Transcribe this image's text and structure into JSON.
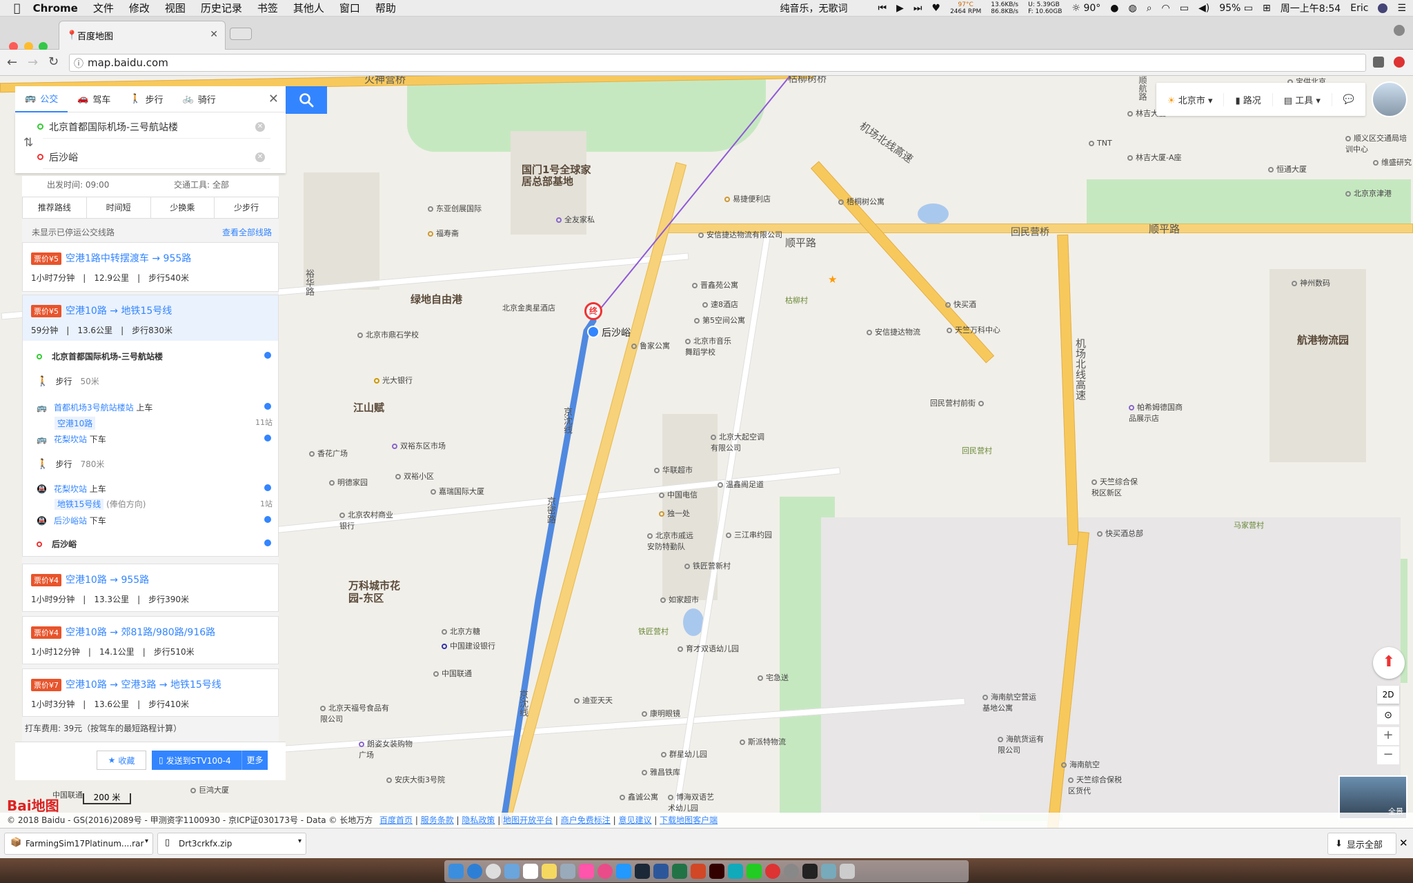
{
  "menubar": {
    "apple": "",
    "app": "Chrome",
    "items": [
      "文件",
      "修改",
      "视图",
      "历史记录",
      "书签",
      "其他人",
      "窗口",
      "帮助"
    ],
    "now_playing": "纯音乐，无歌词",
    "cpu_temp": "97°C",
    "fan": "2464 RPM",
    "net_up": "13.6KB/s",
    "net_down": "86.8KB/s",
    "mem_used": "5.39GB",
    "mem_free": "10.60GB",
    "weather": "90°",
    "battery": "95%",
    "clock": "周一上午8:54",
    "user": "Eric"
  },
  "tabs": {
    "active_title": "百度地图"
  },
  "address": {
    "url": "map.baidu.com"
  },
  "search": {
    "modes": [
      "公交",
      "驾车",
      "步行",
      "骑行"
    ],
    "start": "北京首都国际机场-三号航站楼",
    "end": "后沙峪",
    "depart_time": "出发时间: 09:00",
    "transport": "交通工具: 全部"
  },
  "sort": [
    "推荐路线",
    "时间短",
    "少换乘",
    "少步行"
  ],
  "notice": "未显示已停运公交线路",
  "view_all": "查看全部线路",
  "routes": [
    {
      "price": "票价¥5",
      "title": "空港1路中转摆渡车 → 955路",
      "time": "1小时7分钟",
      "dist": "12.9公里",
      "walk": "步行540米"
    },
    {
      "price": "票价¥5",
      "title": "空港10路 → 地铁15号线",
      "time": "59分钟",
      "dist": "13.6公里",
      "walk": "步行830米"
    },
    {
      "price": "票价¥4",
      "title": "空港10路 → 955路",
      "time": "1小时9分钟",
      "dist": "13.3公里",
      "walk": "步行390米"
    },
    {
      "price": "票价¥4",
      "title": "空港10路 → 郊81路/980路/916路",
      "time": "1小时12分钟",
      "dist": "14.1公里",
      "walk": "步行510米"
    },
    {
      "price": "票价¥7",
      "title": "空港10路 → 空港3路 → 地铁15号线",
      "time": "1小时3分钟",
      "dist": "13.6公里",
      "walk": "步行410米"
    }
  ],
  "detail": {
    "origin": "北京首都国际机场-三号航站楼",
    "walk1": "步行",
    "walk1_dist": "50米",
    "board1_station": "首都机场3号航站楼站",
    "board1_action": "上车",
    "line1": "空港10路",
    "line1_stops": "11站",
    "alight1_station": "花梨坎站",
    "alight1_action": "下车",
    "walk2": "步行",
    "walk2_dist": "780米",
    "board2_station": "花梨坎站",
    "board2_action": "上车",
    "line2": "地铁15号线",
    "line2_dir": "(俸伯方向)",
    "line2_stops": "1站",
    "alight2_station": "后沙峪站",
    "alight2_action": "下车",
    "destination": "后沙峪"
  },
  "taxi": "打车费用: 39元（按驾车的最短路程计算）",
  "buttons": {
    "collect": "收藏",
    "send": "发送到STV100-4",
    "more": "更多"
  },
  "tools": {
    "city": "北京市",
    "traffic": "路况",
    "tools": "工具"
  },
  "map_controls": {
    "mode": "2D",
    "panorama": "全景"
  },
  "scale": "200 米",
  "logo": "Bai地图",
  "copyright": "© 2018 Baidu - GS(2016)2089号 - 甲测资字1100930 - 京ICP证030173号 - Data © 长地万方",
  "footer_links": [
    "百度首页",
    "服务条款",
    "隐私政策",
    "地图开放平台",
    "商户免费标注",
    "意见建议",
    "下载地图客户端"
  ],
  "map_labels": {
    "roads": [
      "火神营桥",
      "枯柳树桥",
      "机场北线高速",
      "顺平路",
      "回民营桥",
      "顺平路",
      "机场北线高速",
      "京沈线",
      "京密路",
      "京沈线",
      "裕华路"
    ],
    "areas": [
      "国门1号全球家居总部基地",
      "绿地自由港",
      "江山赋",
      "万科城市花园-东区",
      "航港物流园",
      "顺航路",
      "后沙峪"
    ],
    "end_marker": "终",
    "pois": [
      "东亚创展国际",
      "福寿斋",
      "全友家私",
      "易捷便利店",
      "梧桐树公寓",
      "安信捷达物流有限公司",
      "晋鑫苑公寓",
      "速8酒店",
      "第5空间公寓",
      "北京金奥星酒店",
      "北京市鼎石学校",
      "鲁家公寓",
      "北京市音乐舞蹈学校",
      "光大银行",
      "快买酒",
      "天竺万科中心",
      "安信捷达物流",
      "回民营村前街",
      "北京大起空调有限公司",
      "华联超市",
      "中国电信",
      "独一处",
      "温鑫阁足道",
      "北京市戚远安防特勤队",
      "三江串约园",
      "铁匠营新村",
      "如家超市",
      "育才双语幼儿园",
      "铁匠营村",
      "宅急送",
      "北京方糖",
      "中国建设银行",
      "中国联通",
      "迪亚天天",
      "康明眼镜",
      "斯派特物流",
      "群星幼儿园",
      "雅昌铁库",
      "鑫诚公寓",
      "博海双语艺术幼儿园",
      "双裕东区市场",
      "双裕小区",
      "嘉瑞国际大厦",
      "明德家园",
      "北京农村商业银行",
      "香花广场",
      "枯柳村",
      "回民营村",
      "天竺综合保税区新区",
      "帕希姆德国商品展示店",
      "快买酒总部",
      "马家营村",
      "海南航空营运基地公寓",
      "海航货运有限公司",
      "海南航空",
      "天竺综合保税区货代",
      "林吉大厦",
      "林吉大厦-A座",
      "TNT",
      "宝供北京物流基地",
      "恒通大厦",
      "顺义区交通局培训中心",
      "维盛研究",
      "北京京津港",
      "神州数码",
      "朗姿女装购物广场",
      "北京天福号食品有限公司",
      "安庆大街3号院",
      "巨鸿大厦",
      "中国联通"
    ]
  },
  "downloads": [
    {
      "name": "FarmingSim17Platinum....rar"
    },
    {
      "name": "Drt3crkfx.zip"
    }
  ],
  "show_all": "显示全部"
}
